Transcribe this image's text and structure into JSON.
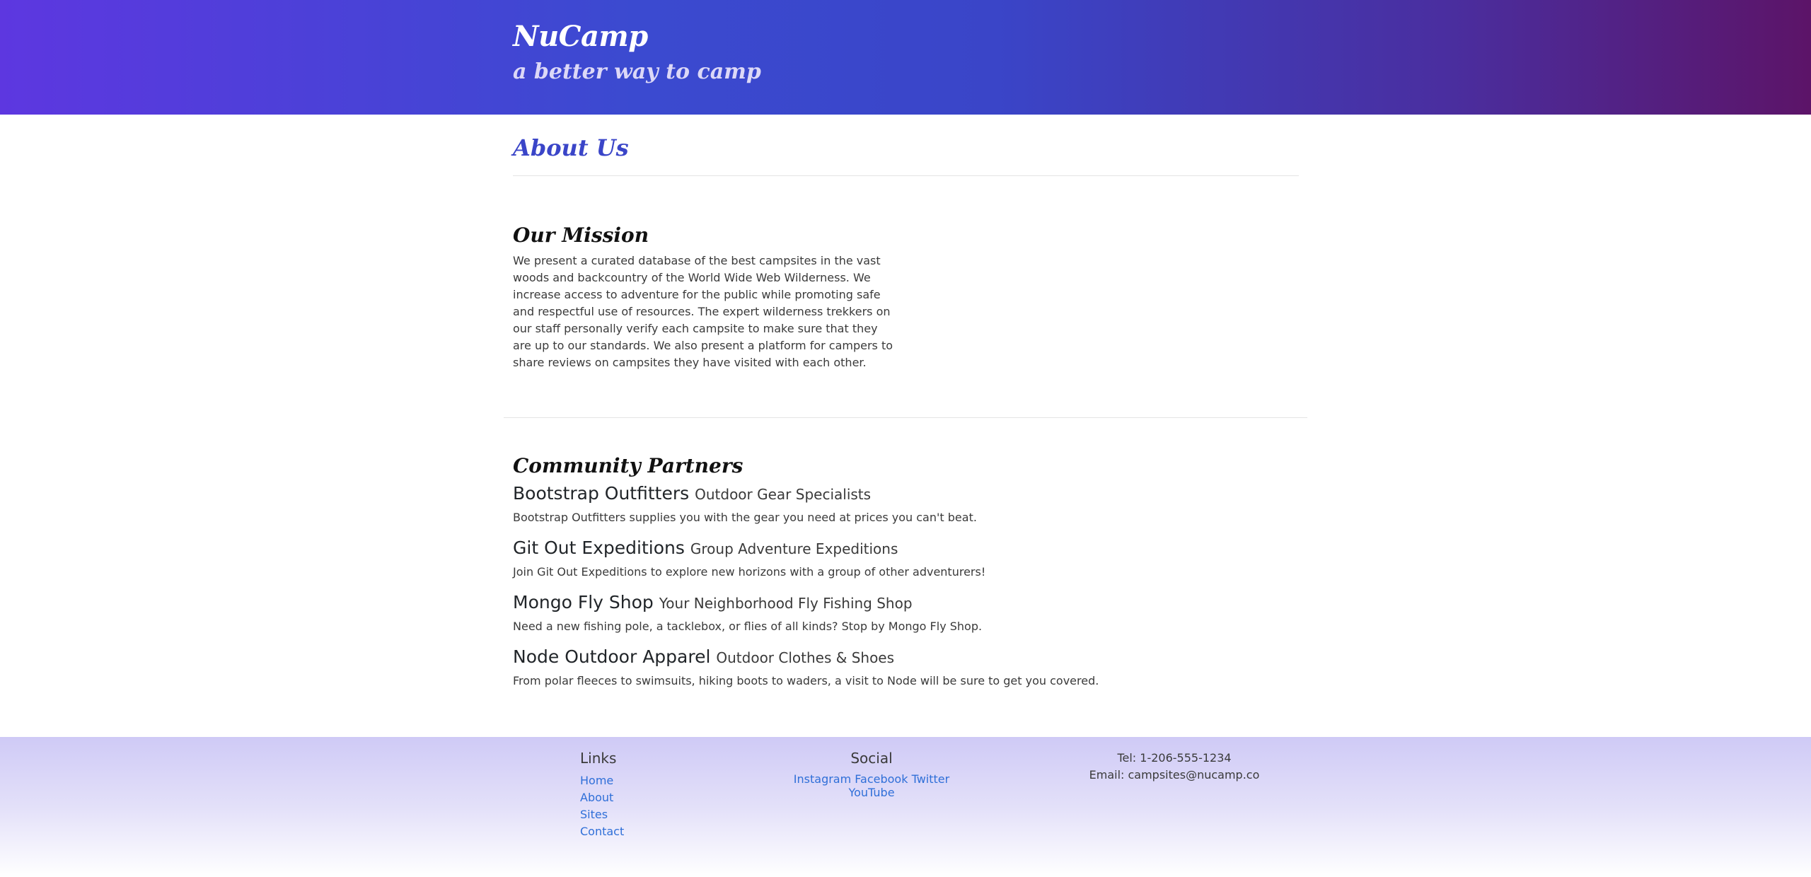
{
  "header": {
    "brand": "NuCamp",
    "tagline": "a better way to camp"
  },
  "page": {
    "title": "About Us"
  },
  "mission": {
    "heading": "Our Mission",
    "text": "We present a curated database of the best campsites in the vast woods and backcountry of the World Wide Web Wilderness. We increase access to adventure for the public while promoting safe and respectful use of resources. The expert wilderness trekkers on our staff personally verify each campsite to make sure that they are up to our standards. We also present a platform for campers to share reviews on campsites they have visited with each other."
  },
  "partners": {
    "heading": "Community Partners",
    "items": [
      {
        "name": "Bootstrap Outfitters",
        "subtitle": "Outdoor Gear Specialists",
        "description": "Bootstrap Outfitters supplies you with the gear you need at prices you can't beat."
      },
      {
        "name": "Git Out Expeditions",
        "subtitle": "Group Adventure Expeditions",
        "description": "Join Git Out Expeditions to explore new horizons with a group of other adventurers!"
      },
      {
        "name": "Mongo Fly Shop",
        "subtitle": "Your Neighborhood Fly Fishing Shop",
        "description": "Need a new fishing pole, a tacklebox, or flies of all kinds? Stop by Mongo Fly Shop."
      },
      {
        "name": "Node Outdoor Apparel",
        "subtitle": "Outdoor Clothes & Shoes",
        "description": "From polar fleeces to swimsuits, hiking boots to waders, a visit to Node will be sure to get you covered."
      }
    ]
  },
  "footer": {
    "links_heading": "Links",
    "links": [
      "Home",
      "About",
      "Sites",
      "Contact"
    ],
    "social_heading": "Social",
    "social": [
      "Instagram",
      "Facebook",
      "Twitter",
      "YouTube"
    ],
    "contact": {
      "tel": "Tel: 1-206-555-1234",
      "email": "Email: campsites@nucamp.co"
    }
  }
}
